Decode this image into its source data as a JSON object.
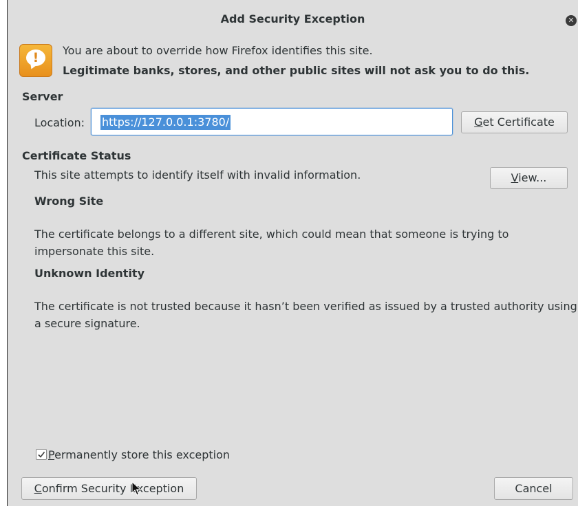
{
  "dialog": {
    "title": "Add Security Exception",
    "close_icon": "close-icon",
    "warning_icon": "warning-speech-bubble-icon",
    "intro_line1": "You are about to override how Firefox identifies this site.",
    "intro_line2": "Legitimate banks, stores, and other public sites will not ask you to do this."
  },
  "server": {
    "heading": "Server",
    "location_label": "Location:",
    "location_value": "https://127.0.0.1:3780/",
    "get_certificate_mnemonic": "G",
    "get_certificate_rest": "et Certificate"
  },
  "certificate_status": {
    "heading": "Certificate Status",
    "summary": "This site attempts to identify itself with invalid information.",
    "view_mnemonic": "V",
    "view_rest": "iew...",
    "wrong_site_heading": "Wrong Site",
    "wrong_site_text_line1": "The certificate belongs to a different site, which could mean that someone is trying to",
    "wrong_site_text_line2": "impersonate this site.",
    "unknown_identity_heading": "Unknown Identity",
    "unknown_identity_text_line1": "The certificate is not trusted because it hasn’t been verified as issued by a trusted authority using",
    "unknown_identity_text_line2": "a secure signature."
  },
  "footer": {
    "permanent_checkbox_checked": true,
    "permanent_mnemonic": "P",
    "permanent_rest": "ermanently store this exception",
    "confirm_mnemonic": "C",
    "confirm_rest": "onfirm Security Exception",
    "cancel_label": "Cancel"
  },
  "colors": {
    "dialog_background": "#dedede",
    "selection_accent": "#4a90d9",
    "warning_orange": "#eea12a"
  }
}
